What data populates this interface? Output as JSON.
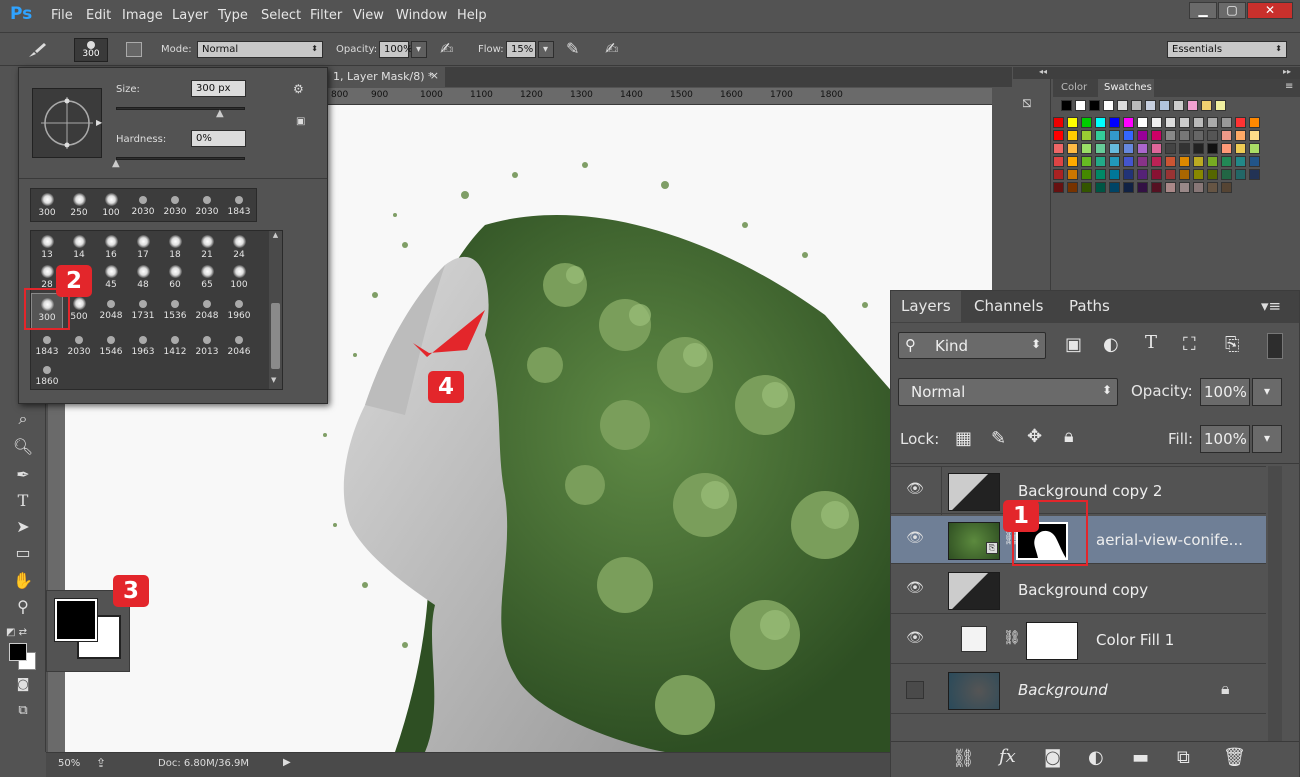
{
  "app": {
    "logo": "Ps",
    "menus": [
      "File",
      "Edit",
      "Image",
      "Layer",
      "Type",
      "Select",
      "Filter",
      "View",
      "Window",
      "Help"
    ],
    "window_buttons": [
      "▁",
      "▢",
      "✕"
    ]
  },
  "options": {
    "brush_size": "300",
    "mode_label": "Mode:",
    "mode_value": "Normal",
    "opacity_label": "Opacity:",
    "opacity_value": "100%",
    "flow_label": "Flow:",
    "flow_value": "15%",
    "workspace": "Essentials"
  },
  "document": {
    "tab_title": "1, Layer Mask/8) *",
    "close": "×"
  },
  "ruler": {
    "ticks": [
      "800",
      "900",
      "1000",
      "1100",
      "1200",
      "1300",
      "1400",
      "1500",
      "1600",
      "1700",
      "1800"
    ]
  },
  "brush_picker": {
    "size_label": "Size:",
    "size_value": "300 px",
    "hardness_label": "Hardness:",
    "hardness_value": "0%",
    "recent": [
      "300",
      "250",
      "100",
      "2030",
      "2030",
      "2030",
      "1843"
    ],
    "presets_row1": [
      "13",
      "14",
      "16",
      "17",
      "18",
      "21",
      "24"
    ],
    "presets_row2": [
      "28",
      "",
      "45",
      "48",
      "60",
      "65",
      "100"
    ],
    "presets_row3": [
      "300",
      "500",
      "2048",
      "1731",
      "1536",
      "2048",
      "1960"
    ],
    "presets_row4": [
      "1843",
      "2030",
      "1546",
      "1963",
      "1412",
      "2013",
      "2046"
    ],
    "presets_row5": [
      "1860"
    ]
  },
  "status": {
    "zoom": "50%",
    "doc": "Doc: 6.80M/36.9M"
  },
  "swatches": {
    "tab_color": "Color",
    "tab_swatches": "Swatches"
  },
  "layers": {
    "tabs": [
      "Layers",
      "Channels",
      "Paths"
    ],
    "kind_label": "Kind",
    "blend_mode": "Normal",
    "opacity_label": "Opacity:",
    "opacity_value": "100%",
    "lock_label": "Lock:",
    "fill_label": "Fill:",
    "fill_value": "100%",
    "rows": [
      {
        "name": "Background copy 2"
      },
      {
        "name": "aerial-view-conife..."
      },
      {
        "name": "Background copy"
      },
      {
        "name": "Color Fill 1"
      },
      {
        "name": "Background"
      }
    ],
    "bottom_fx": "fx"
  },
  "badges": {
    "b1": "1",
    "b2": "2",
    "b3": "3",
    "b4": "4"
  },
  "colors": {
    "accent_red": "#e3262b",
    "panel": "#535353",
    "selected_layer": "#6f7f96"
  }
}
